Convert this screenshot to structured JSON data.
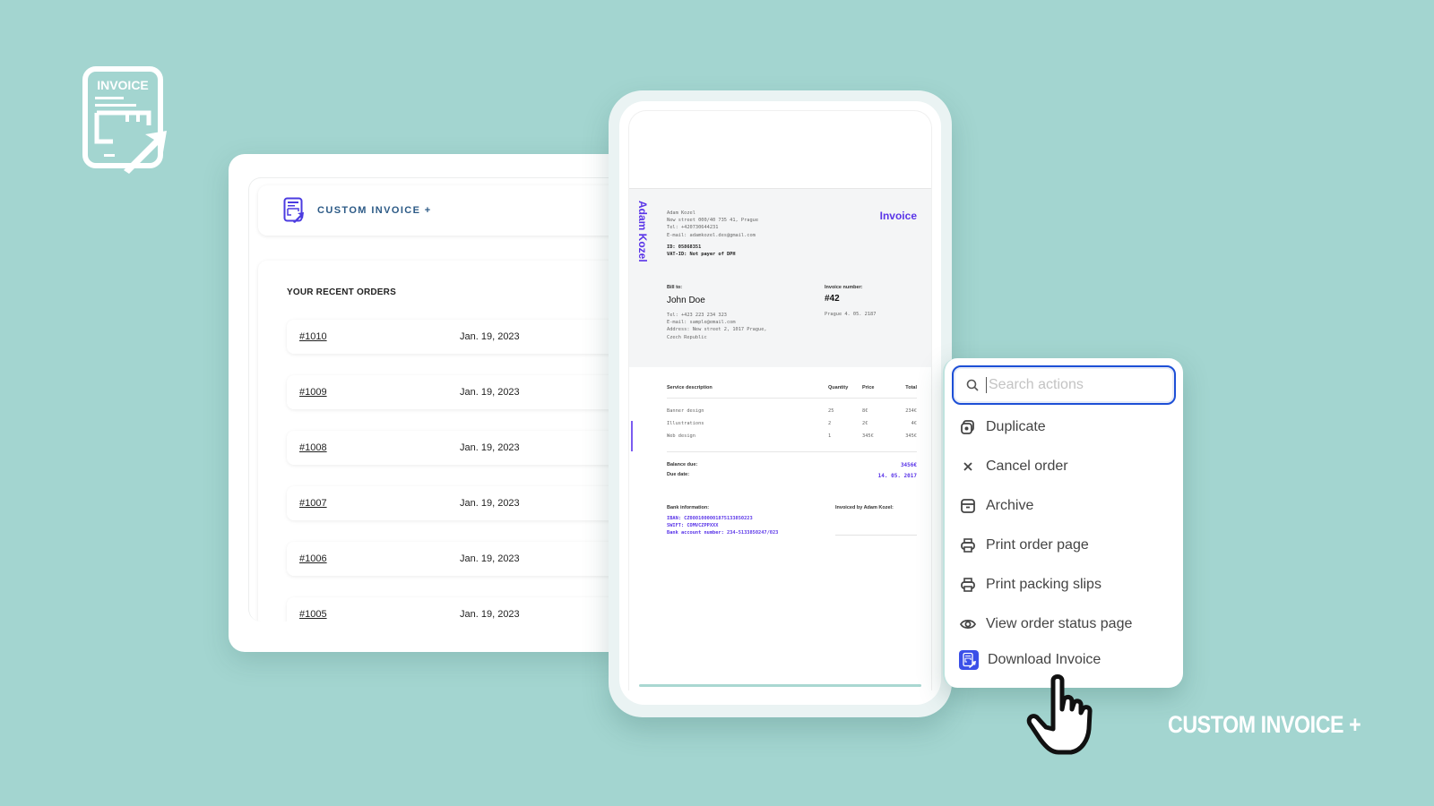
{
  "brand": {
    "logo_text": "INVOICE",
    "app_name": "CUSTOM INVOICE +",
    "tagline": "CUSTOM INVOICE +"
  },
  "orders": {
    "title": "YOUR RECENT ORDERS",
    "rows": [
      {
        "id": "#1010",
        "date": "Jan. 19, 2023"
      },
      {
        "id": "#1009",
        "date": "Jan. 19, 2023"
      },
      {
        "id": "#1008",
        "date": "Jan. 19, 2023"
      },
      {
        "id": "#1007",
        "date": "Jan. 19, 2023"
      },
      {
        "id": "#1006",
        "date": "Jan. 19, 2023"
      },
      {
        "id": "#1005",
        "date": "Jan. 19, 2023"
      }
    ]
  },
  "invoice": {
    "vertical_name": "Adam Kozel",
    "title": "Invoice",
    "sender": {
      "name": "Adam Kozel",
      "address": "New street 000/40 735 41, Prague",
      "tel": "Tel: +420730644231",
      "email": "E-mail: adamkozel.des@gmail.com",
      "id": "ID: 05868351",
      "vat": "VAT-ID: Not payer of DPH"
    },
    "bill_to_label": "Bill to:",
    "bill_to_name": "John Doe",
    "bill_to_tel": "Tel: +423 223 234 323",
    "bill_to_email": "E-mail: sample@email.com",
    "bill_to_address": "Address: New street 2, 1017 Prague,",
    "bill_to_country": "Czech Republic",
    "invoice_number_label": "Invoice number:",
    "invoice_number": "#42",
    "invoice_date": "Prague 4. 05. 2187",
    "table": {
      "headers": {
        "desc": "Service description",
        "qty": "Quantity",
        "price": "Price",
        "total": "Total"
      },
      "rows": [
        {
          "desc": "Banner design",
          "qty": "25",
          "price": "8€",
          "total": "234€"
        },
        {
          "desc": "Illustrations",
          "qty": "2",
          "price": "2€",
          "total": "4€"
        },
        {
          "desc": "Web design",
          "qty": "1",
          "price": "345€",
          "total": "345€"
        }
      ]
    },
    "balance_label": "Balance due:",
    "balance_value": "3456€",
    "due_label": "Due date:",
    "due_value": "14. 05. 2017",
    "bank_label": "Bank information:",
    "iban": "IBAN: CZ0801000001875133850223",
    "swift": "SWIFT: COMVCZPPXXX",
    "bank_account": "Bank account number: 234-5133850247/023",
    "invoiced_by": "Invoiced by Adam Kozel:"
  },
  "actions": {
    "search_placeholder": "Search actions",
    "items": [
      {
        "label": "Duplicate",
        "icon": "duplicate-icon"
      },
      {
        "label": "Cancel order",
        "icon": "close-icon"
      },
      {
        "label": "Archive",
        "icon": "archive-icon"
      },
      {
        "label": "Print order page",
        "icon": "printer-icon"
      },
      {
        "label": "Print packing slips",
        "icon": "printer-icon"
      },
      {
        "label": "View order status page",
        "icon": "eye-icon"
      },
      {
        "label": "Download Invoice",
        "icon": "invoice-app-icon"
      }
    ]
  },
  "colors": {
    "background": "#a3d5d0",
    "accent_purple": "#5a35e8",
    "search_focus": "#1d4fd6",
    "app_name_blue": "#2c5a86"
  }
}
